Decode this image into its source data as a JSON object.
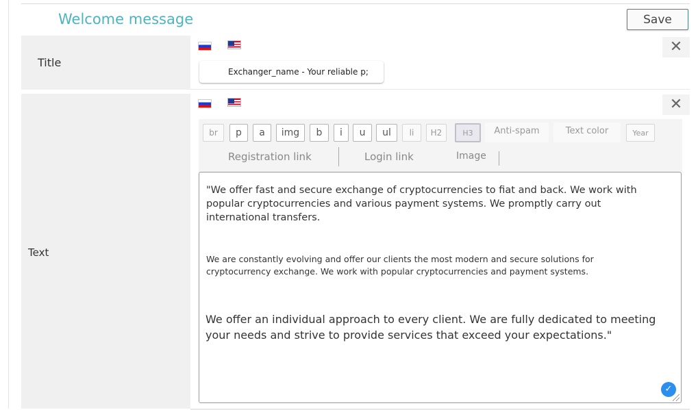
{
  "header": {
    "title": "Welcome message",
    "save_label": "Save"
  },
  "title_field": {
    "label": "Title",
    "languages": [
      "ru-flag-icon",
      "us-flag-icon"
    ],
    "value": "Exchanger_name - Your reliable p;",
    "remove_icon": "close-icon"
  },
  "text_field": {
    "label": "Text",
    "languages": [
      "ru-flag-icon",
      "us-flag-icon"
    ],
    "remove_icon": "close-icon",
    "toolbar": {
      "br": "br",
      "p": "p",
      "a": "a",
      "img": "img",
      "b": "b",
      "i": "i",
      "u": "u",
      "ul": "ul",
      "li": "li",
      "h2": "H2",
      "h3": "H3",
      "anti_spam": "Anti-spam",
      "text_color": "Text color",
      "year": "Year",
      "registration_link": "Registration link",
      "login_link": "Login link",
      "image": "Image"
    },
    "content": {
      "paragraph1": "\"We offer fast and secure exchange of cryptocurrencies to fiat and back. We work with popular cryptocurrencies and various payment systems. We promptly carry out international transfers.",
      "paragraph2": "We are constantly evolving and offer our clients the most modern and secure solutions for cryptocurrency exchange. We work with popular cryptocurrencies and payment systems.",
      "paragraph3": "We offer an individual approach to every client. We are fully dedicated to meeting your needs and strive to provide services that exceed your expectations.\""
    },
    "status_icon": "check-icon",
    "accent_color": "#2c8ff0"
  },
  "colors": {
    "title_accent": "#4fb3bf",
    "label_background": "#f0f0f0"
  }
}
